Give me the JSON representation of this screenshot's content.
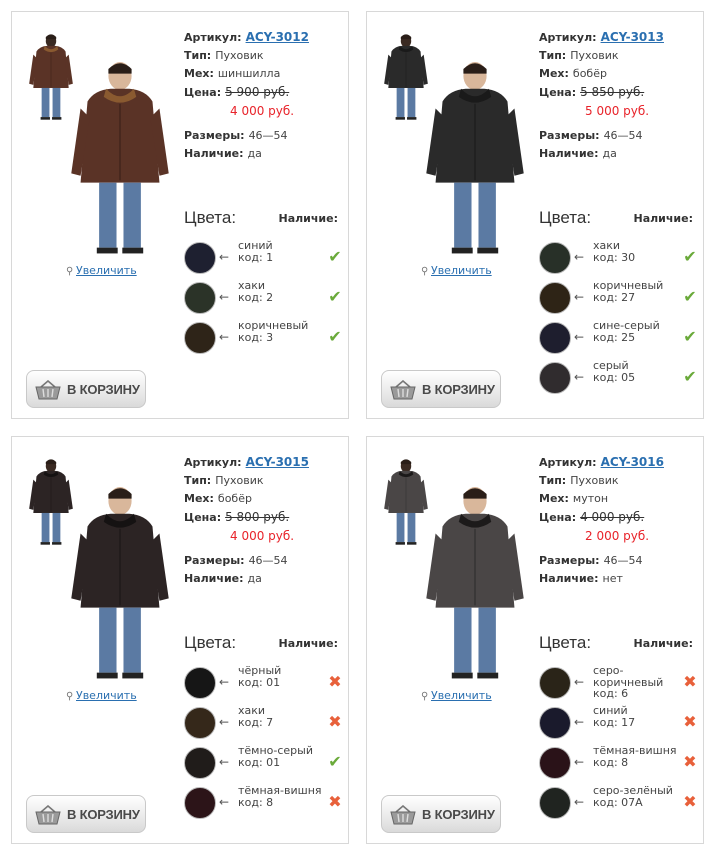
{
  "labels": {
    "sku": "Артикул:",
    "type": "Тип:",
    "fur": "Мех:",
    "price": "Цена:",
    "sizes": "Размеры:",
    "availability": "Наличие:",
    "colors_title": "Цвета:",
    "availability_title": "Наличие:",
    "zoom": "Увеличить",
    "cart": "В КОРЗИНУ",
    "arrow": "←"
  },
  "icons": {
    "zoom": "magnifier-icon",
    "cart": "basket-icon",
    "available": "checkmark-icon",
    "unavailable": "cross-icon"
  },
  "products": [
    {
      "sku": "ACY-3012",
      "type": "Пуховик",
      "fur": "шиншилла",
      "old_price": "5 900 руб.",
      "new_price": "4 000 руб.",
      "sizes": "46—54",
      "in_stock": "да",
      "jacket_color": "#5a3326",
      "collar_color": "#8a5a30",
      "colors": [
        {
          "name": "синий",
          "code": "код: 1",
          "hex": "#1e2030",
          "available": true
        },
        {
          "name": "хаки",
          "code": "код: 2",
          "hex": "#2b3328",
          "available": true
        },
        {
          "name": "коричневый",
          "code": "код: 3",
          "hex": "#2e2418",
          "available": true
        }
      ]
    },
    {
      "sku": "ACY-3013",
      "type": "Пуховик",
      "fur": "бобёр",
      "old_price": "5 850 руб.",
      "new_price": "5 000 руб.",
      "sizes": "46—54",
      "in_stock": "да",
      "jacket_color": "#2a2a2a",
      "collar_color": "#1a1a1a",
      "colors": [
        {
          "name": "хаки",
          "code": "код: 30",
          "hex": "#283028",
          "available": true
        },
        {
          "name": "коричневый",
          "code": "код: 27",
          "hex": "#2e2416",
          "available": true
        },
        {
          "name": "сине-серый",
          "code": "код: 25",
          "hex": "#1e1e2e",
          "available": true
        },
        {
          "name": "серый",
          "code": "код: 05",
          "hex": "#302c2e",
          "available": true
        }
      ]
    },
    {
      "sku": "ACY-3015",
      "type": "Пуховик",
      "fur": "бобёр",
      "old_price": "5 800 руб.",
      "new_price": "4 000 руб.",
      "sizes": "46—54",
      "in_stock": "да",
      "jacket_color": "#2c2424",
      "collar_color": "#151212",
      "colors": [
        {
          "name": "чёрный",
          "code": "код: 01",
          "hex": "#161616",
          "available": false
        },
        {
          "name": "хаки",
          "code": "код: 7",
          "hex": "#35281a",
          "available": false
        },
        {
          "name": "тёмно-серый",
          "code": "код: 01",
          "hex": "#201c1a",
          "available": true
        },
        {
          "name": "тёмная-вишня",
          "code": "код: 8",
          "hex": "#2c1418",
          "available": false
        }
      ]
    },
    {
      "sku": "ACY-3016",
      "type": "Пуховик",
      "fur": "мутон",
      "old_price": "4 000 руб.",
      "new_price": "2 000 руб.",
      "sizes": "46—54",
      "in_stock": "нет",
      "jacket_color": "#4a4646",
      "collar_color": "#1c1a1a",
      "colors": [
        {
          "name": "серо-коричневый",
          "code": "код: 6",
          "hex": "#2a2418",
          "available": false
        },
        {
          "name": "синий",
          "code": "код: 17",
          "hex": "#1a1a2c",
          "available": false
        },
        {
          "name": "тёмная-вишня",
          "code": "код: 8",
          "hex": "#2a1218",
          "available": false
        },
        {
          "name": "серо-зелёный",
          "code": "код: 07А",
          "hex": "#202420",
          "available": false
        }
      ]
    }
  ]
}
